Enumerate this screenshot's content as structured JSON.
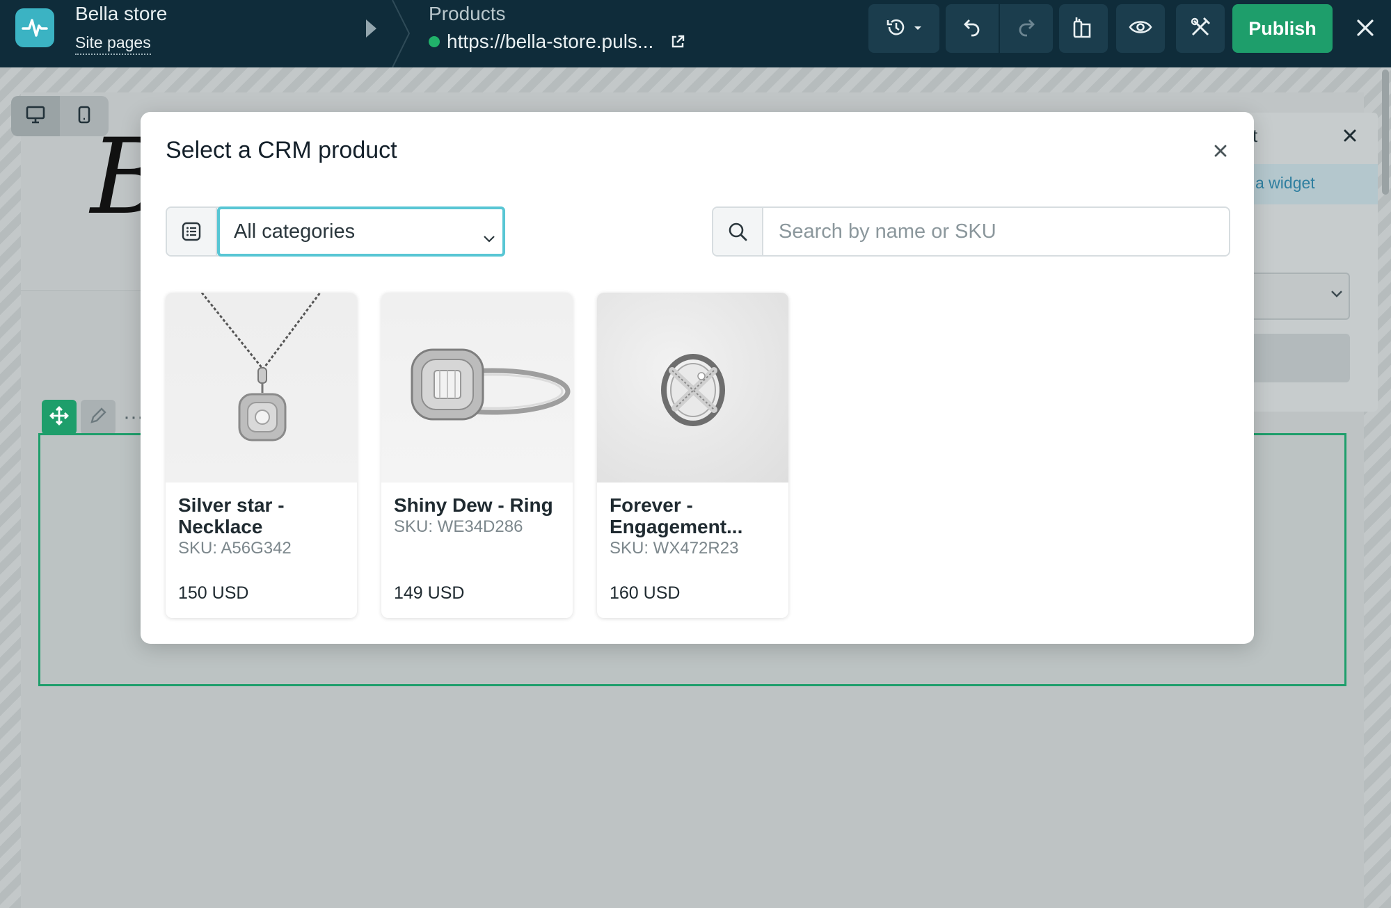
{
  "topbar": {
    "site_name": "Bella store",
    "site_pages": "Site pages",
    "page_name": "Products",
    "page_url": "https://bella-store.puls...",
    "publish_label": "Publish",
    "colors": {
      "bar": "#0f2c3a",
      "publish": "#1e9e6b",
      "status": "#21b26a"
    }
  },
  "canvas": {
    "logo_glyph": "B",
    "side_panel": {
      "title_tail": "t",
      "link_tail": "a widget"
    }
  },
  "modal": {
    "title": "Select a CRM product",
    "category_select": "All categories",
    "search_placeholder": "Search by name or SKU",
    "products": [
      {
        "name": "Silver star - Necklace",
        "sku": "SKU: A56G342",
        "price": "150 USD"
      },
      {
        "name": "Shiny Dew - Ring",
        "sku": "SKU: WE34D286",
        "price": "149 USD"
      },
      {
        "name": "Forever - Engagement...",
        "sku": "SKU: WX472R23",
        "price": "160 USD"
      }
    ]
  },
  "icons": {
    "logo": "pulse-icon",
    "history": "history-icon",
    "undo": "undo-icon",
    "redo": "redo-icon",
    "preview": "eye-icon",
    "close": "close-icon",
    "search": "search-icon",
    "category": "list-icon"
  }
}
